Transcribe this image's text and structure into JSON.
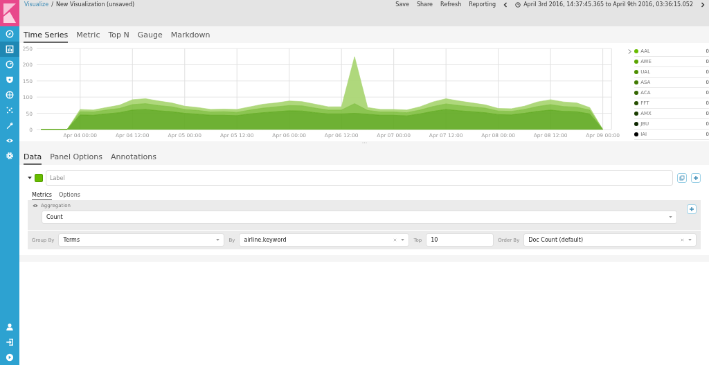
{
  "sidebar": {
    "items": [
      {
        "kind": "compass",
        "selected": false
      },
      {
        "kind": "chart",
        "selected": true
      },
      {
        "kind": "gauge",
        "selected": false
      },
      {
        "kind": "shield",
        "selected": false
      },
      {
        "kind": "globe",
        "selected": false
      },
      {
        "kind": "sparkle",
        "selected": false
      },
      {
        "kind": "wrench",
        "selected": false
      },
      {
        "kind": "eye",
        "selected": false
      },
      {
        "kind": "gear",
        "selected": false
      }
    ],
    "bottom_items": [
      {
        "kind": "user"
      },
      {
        "kind": "logout"
      },
      {
        "kind": "play"
      }
    ]
  },
  "breadcrumb": {
    "parent": "Visualize",
    "separator": "/",
    "current": "New Visualization (unsaved)"
  },
  "top_menu": [
    "Save",
    "Share",
    "Refresh",
    "Reporting"
  ],
  "time_range": "April 3rd 2016, 14:37:45.365 to April 9th 2016, 03:36:15.052",
  "viz_tabs": [
    {
      "label": "Time Series",
      "selected": true
    },
    {
      "label": "Metric",
      "selected": false
    },
    {
      "label": "Top N",
      "selected": false
    },
    {
      "label": "Gauge",
      "selected": false
    },
    {
      "label": "Markdown",
      "selected": false
    }
  ],
  "chart_data": {
    "type": "area",
    "stacked": true,
    "grid": true,
    "ylim": [
      0,
      250
    ],
    "yticks": [
      0,
      50,
      100,
      150,
      200,
      250
    ],
    "categories": [
      null,
      null,
      null,
      "Apr 04 00:00",
      null,
      null,
      null,
      "Apr 04 12:00",
      null,
      null,
      null,
      "Apr 05 00:00",
      null,
      null,
      null,
      "Apr 05 12:00",
      null,
      null,
      null,
      "Apr 06 00:00",
      null,
      null,
      null,
      "Apr 06 12:00",
      null,
      null,
      null,
      "Apr 07 00:00",
      null,
      null,
      null,
      "Apr 07 12:00",
      null,
      null,
      null,
      "Apr 08 00:00",
      null,
      null,
      null,
      "Apr 08 12:00",
      null,
      null,
      null,
      "Apr 09 00:00"
    ],
    "series": [
      {
        "color": "#5ea81e",
        "values": [
          0,
          0,
          0,
          45,
          44,
          48,
          52,
          60,
          62,
          58,
          55,
          50,
          47,
          44,
          44,
          43,
          48,
          52,
          55,
          58,
          57,
          52,
          48,
          48,
          50,
          47,
          44,
          44,
          42,
          48,
          56,
          62,
          58,
          55,
          52,
          46,
          45,
          50,
          56,
          60,
          56,
          55,
          48,
          0
        ]
      },
      {
        "color": "#7fbf3f",
        "values": [
          0,
          0,
          0,
          10,
          10,
          12,
          13,
          17,
          18,
          16,
          15,
          12,
          12,
          10,
          11,
          10,
          12,
          14,
          15,
          16,
          16,
          14,
          12,
          12,
          30,
          12,
          10,
          10,
          10,
          12,
          15,
          17,
          16,
          15,
          14,
          11,
          11,
          12,
          15,
          17,
          15,
          14,
          12,
          0
        ]
      },
      {
        "color": "#a6d46e",
        "values": [
          0,
          0,
          0,
          7,
          6,
          8,
          10,
          15,
          15,
          14,
          12,
          10,
          9,
          8,
          8,
          9,
          10,
          12,
          12,
          14,
          13,
          12,
          10,
          10,
          145,
          9,
          8,
          8,
          8,
          10,
          14,
          16,
          14,
          12,
          10,
          8,
          8,
          10,
          14,
          15,
          14,
          13,
          8,
          0
        ]
      }
    ]
  },
  "legend": [
    {
      "name": "AAL",
      "value": "0",
      "color": "#68bc00"
    },
    {
      "name": "AWE",
      "value": "0",
      "color": "#5aa400"
    },
    {
      "name": "UAL",
      "value": "0",
      "color": "#4d8f00"
    },
    {
      "name": "ASA",
      "value": "0",
      "color": "#407a00"
    },
    {
      "name": "ACA",
      "value": "0",
      "color": "#336600"
    },
    {
      "name": "FFT",
      "value": "0",
      "color": "#264f00"
    },
    {
      "name": "AMX",
      "value": "0",
      "color": "#1a3d00"
    },
    {
      "name": "JBU",
      "value": "0",
      "color": "#0d2600"
    },
    {
      "name": "IAI",
      "value": "0",
      "color": "#000000"
    }
  ],
  "panel_tabs": [
    {
      "label": "Data",
      "selected": true
    },
    {
      "label": "Panel Options",
      "selected": false
    },
    {
      "label": "Annotations",
      "selected": false
    }
  ],
  "series_editor": {
    "color": "#68bc00",
    "label_placeholder": "Label",
    "tabs": [
      {
        "label": "Metrics",
        "selected": true
      },
      {
        "label": "Options",
        "selected": false
      }
    ],
    "aggregation": {
      "label": "Aggregation",
      "value": "Count"
    },
    "group_by": {
      "label": "Group By",
      "value": "Terms"
    },
    "by": {
      "label": "By",
      "value": "airline.keyword"
    },
    "top": {
      "label": "Top",
      "value": "10"
    },
    "order_by": {
      "label": "Order By",
      "value": "Doc Count (default)"
    }
  }
}
